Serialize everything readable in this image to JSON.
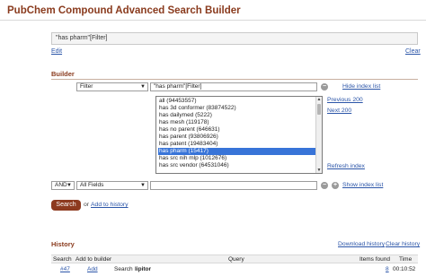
{
  "page": {
    "title": "PubChem Compound Advanced Search Builder"
  },
  "query_box": {
    "value": "\"has pharm\"[Filter]",
    "edit_label": "Edit",
    "clear_label": "Clear"
  },
  "builder": {
    "heading": "Builder",
    "row1": {
      "field_value": "Filter",
      "term_value": "\"has pharm\"[Filter]",
      "hide_index_label": "Hide index list"
    },
    "index_list": {
      "items": [
        "all (94453557)",
        "has 3d conformer (83874522)",
        "has dailymed (5222)",
        "has mesh (119178)",
        "has no parent (646631)",
        "has parent (93806926)",
        "has patent (19483404)",
        "has pharm (15417)",
        "has src nih mlp (1012676)",
        "has src vendor (64531046)"
      ],
      "selected_index": 7,
      "previous_label": "Previous 200",
      "next_label": "Next 200",
      "refresh_label": "Refresh index"
    },
    "row2": {
      "bool_value": "AND",
      "field_value": "All Fields",
      "term_value": "",
      "show_index_label": "Show index list"
    },
    "search_label": "Search",
    "or_text": "or",
    "add_history_label": "Add to history"
  },
  "history": {
    "heading": "History",
    "download_label": "Download history",
    "clear_label": "Clear history",
    "columns": [
      "Search",
      "Add to builder",
      "Query",
      "Items found",
      "Time"
    ],
    "rows": [
      {
        "search": "#47",
        "add": "Add",
        "query_prefix": "Search",
        "query_term": "lipitor",
        "items": "8",
        "time": "00:10:52"
      }
    ]
  }
}
